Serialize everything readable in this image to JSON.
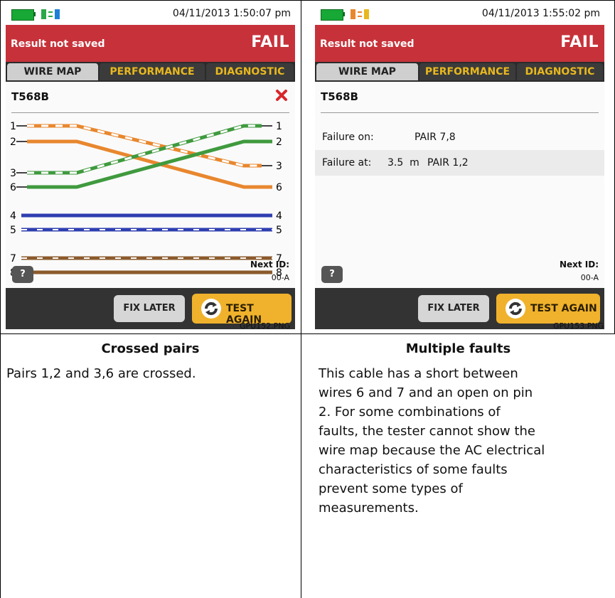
{
  "left": {
    "status_time": "04/11/2013 1:50:07 pm",
    "banner_msg": "Result not saved",
    "banner_result": "FAIL",
    "tabs": [
      "WIRE MAP",
      "PERFORMANCE",
      "DIAGNOSTIC"
    ],
    "standard": "T568B",
    "pins": [
      "1",
      "2",
      "3",
      "6",
      "4",
      "5",
      "7",
      "8"
    ],
    "help": "?",
    "next_id_label": "Next ID:",
    "next_id_value": "00-A",
    "fix_later": "FIX LATER",
    "test_again": "TEST AGAIN",
    "filename": "GPU152.PNG",
    "title": "Crossed pairs",
    "description": "Pairs 1,2 and 3,6 are crossed."
  },
  "right": {
    "status_time": "04/11/2013 1:55:02 pm",
    "banner_msg": "Result not saved",
    "banner_result": "FAIL",
    "tabs": [
      "WIRE MAP",
      "PERFORMANCE",
      "DIAGNOSTIC"
    ],
    "standard": "T568B",
    "failure_on_label": "Failure on:",
    "failure_on_value": "PAIR 7,8",
    "failure_at_label": "Failure at:",
    "failure_at_distance": "3.5  m",
    "failure_at_value": "PAIR 1,2",
    "help": "?",
    "next_id_label": "Next ID:",
    "next_id_value": "00-A",
    "fix_later": "FIX LATER",
    "test_again": "TEST AGAIN",
    "filename": "GPU153.PNG",
    "title": "Multiple faults",
    "description_lines": [
      "This cable has a short between",
      "wires 6 and 7 and an open on pin",
      "2. For some combinations of",
      "faults, the tester cannot show the",
      "wire map because the AC electrical",
      "characteristics of some faults",
      "prevent some types of",
      "measurements."
    ]
  },
  "colors": {
    "fail_red": "#c7323a",
    "tab_yellow": "#e8b81e",
    "orange": "#e8872e",
    "green": "#3f9a3e",
    "blue": "#2f3fb0",
    "brown": "#8b5a2b"
  }
}
